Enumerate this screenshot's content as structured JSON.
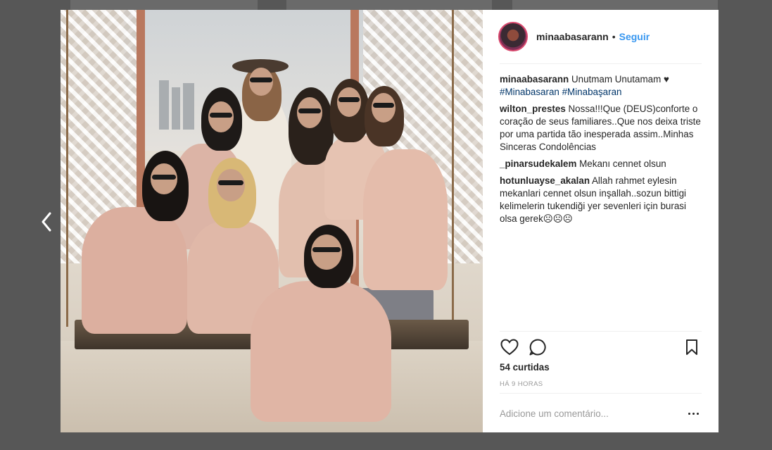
{
  "post": {
    "username": "minaabasarann",
    "separator": "•",
    "follow_label": "Seguir"
  },
  "comments": [
    {
      "user": "minaabasarann",
      "text": "Unutmam Unutamam ♥",
      "tags": [
        "#Minabasaran",
        "#Minabaşaran"
      ]
    },
    {
      "user": "wilton_prestes",
      "text": "Nossa!!!Que (DEUS)conforte o coração de seus familiares..Que nos deixa triste por uma partida tão inesperada assim..Minhas Sinceras Condolências"
    },
    {
      "user": "_pinarsudekalem",
      "text": "Mekanı cennet olsun"
    },
    {
      "user": "hotunluayse_akalan",
      "text": "Allah rahmet eylesin mekanlari cennet olsun inşallah..sozun bittigi kelimelerin tukendiği yer sevenleri için burasi olsa gerek☹☹☹"
    }
  ],
  "likes": "54 curtidas",
  "time_ago": "HÁ 9 HORAS",
  "add_comment_placeholder": "Adicione um comentário...",
  "icons": {
    "prev": "chevron-left-icon",
    "like": "heart-icon",
    "comment": "comment-icon",
    "save": "bookmark-icon",
    "more": "more-options-icon"
  },
  "colors": {
    "background": "#575757",
    "follow": "#3897f0",
    "hashtag": "#003569",
    "text": "#262626",
    "muted": "#999999"
  }
}
